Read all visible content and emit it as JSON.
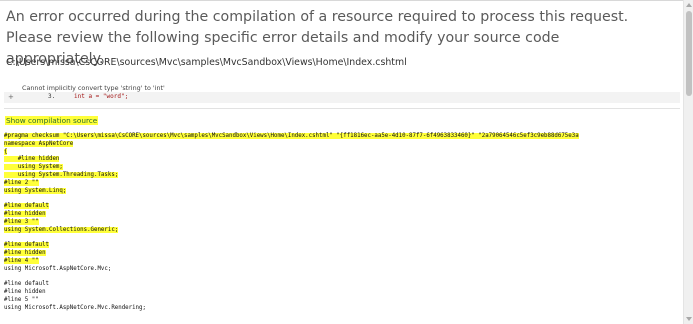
{
  "error": {
    "headline": "An error occurred during the compilation of a resource required to process this request. Please review the following specific error details and modify your source code appropriately.",
    "file_path": "C:\\Users\\missa\\CsCORE\\sources\\Mvc\\samples\\MvcSandbox\\Views\\Home\\Index.cshtml",
    "message": "Cannot implicitly convert type 'string' to 'int'",
    "expand_symbol": "+",
    "line_number": "3.",
    "code": "int a = \"word\";"
  },
  "compilation": {
    "toggle_label": "Show compilation source",
    "lines": [
      "#pragma checksum \"C:\\Users\\missa\\CsCORE\\sources\\Mvc\\samples\\MvcSandbox\\Views\\Home\\Index.cshtml\" \"{ff1816ec-aa5e-4d10-87f7-6f4963833460}\" \"2a79064546c5ef3c9eb88d675e3a",
      "namespace AspNetCore",
      "{",
      "    #line hidden",
      "    using System;",
      "    using System.Threading.Tasks;",
      "#line 2 \"\"",
      "using System.Linq;",
      "",
      "#line default",
      "#line hidden",
      "#line 3 \"\"",
      "using System.Collections.Generic;",
      "",
      "#line default",
      "#line hidden",
      "#line 4 \"\"",
      "using Microsoft.AspNetCore.Mvc;",
      "",
      "#line default",
      "#line hidden",
      "#line 5 \"\"",
      "using Microsoft.AspNetCore.Mvc.Rendering;"
    ]
  },
  "colors": {
    "highlight": "#ffff3a",
    "code_string": "#a31515"
  }
}
